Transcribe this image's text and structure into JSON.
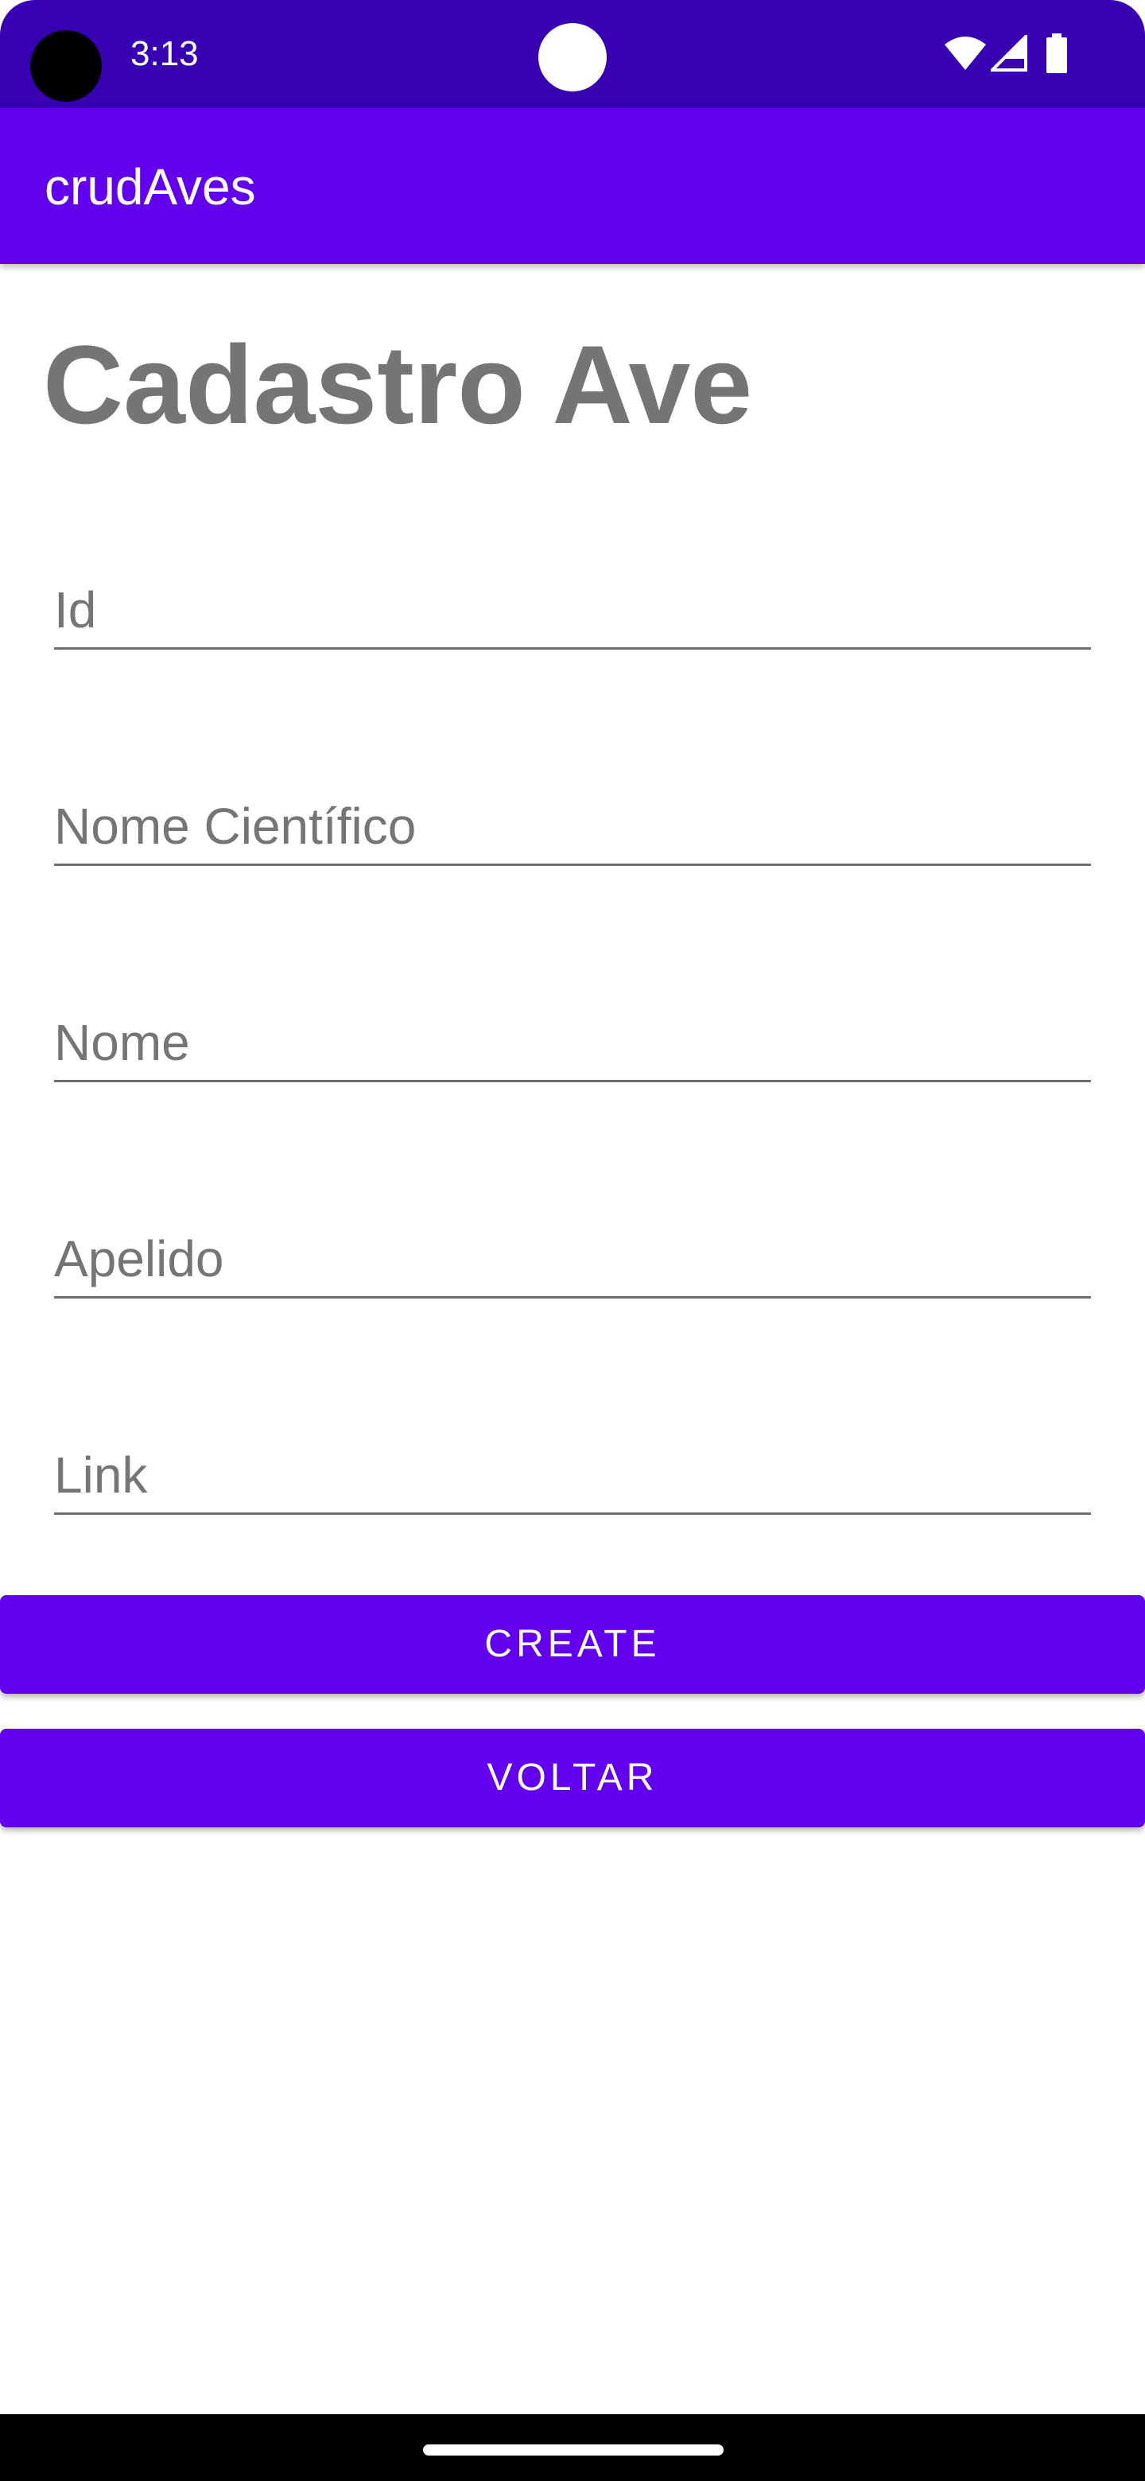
{
  "status_bar": {
    "time": "3:13",
    "icons": [
      "wifi-icon",
      "cell-signal-icon",
      "battery-icon"
    ],
    "color": "#3700b3"
  },
  "app_bar": {
    "title": "crudAves",
    "color": "#6200ee"
  },
  "page": {
    "title": "Cadastro Ave"
  },
  "form": {
    "fields": [
      {
        "placeholder": "Id",
        "value": ""
      },
      {
        "placeholder": "Nome Científico",
        "value": ""
      },
      {
        "placeholder": "Nome",
        "value": ""
      },
      {
        "placeholder": "Apelido",
        "value": ""
      },
      {
        "placeholder": "Link",
        "value": ""
      }
    ]
  },
  "buttons": {
    "create_label": "CREATE",
    "voltar_label": "VOLTAR",
    "color": "#6200ee"
  }
}
